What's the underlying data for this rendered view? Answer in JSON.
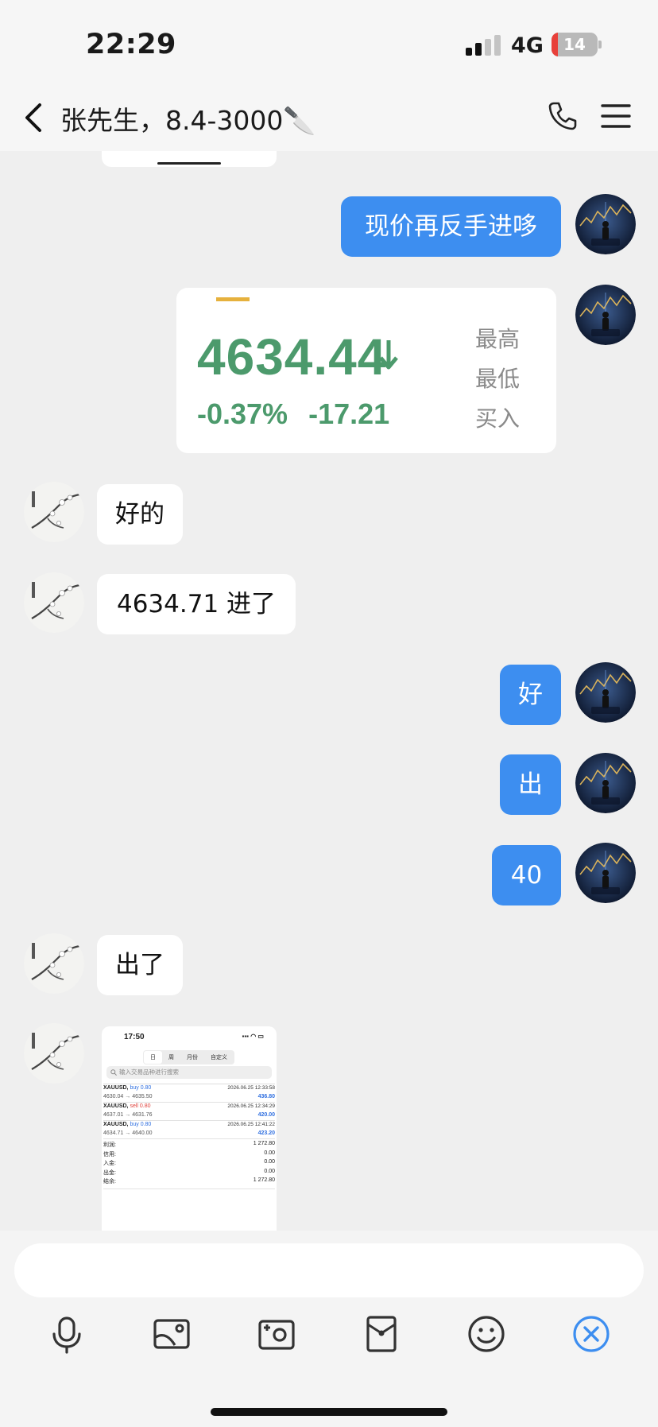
{
  "status_bar": {
    "time": "22:29",
    "network": "4G",
    "battery": "14",
    "battery_level": 0.14
  },
  "header": {
    "title": "张先生，8.4-3000🔪"
  },
  "messages": [
    {
      "from": "me",
      "text": "现价再反手进哆"
    },
    {
      "from": "me",
      "type": "quote_card",
      "price": "4634.44",
      "change_pct": "-0.37%",
      "change_abs": "-17.21",
      "labels": [
        "最高",
        "最低",
        "买入"
      ]
    },
    {
      "from": "other",
      "text": "好的"
    },
    {
      "from": "other",
      "text": "4634.71 进了"
    },
    {
      "from": "me",
      "text": "好"
    },
    {
      "from": "me",
      "text": "出"
    },
    {
      "from": "me",
      "text": "40"
    },
    {
      "from": "other",
      "text": "出了"
    },
    {
      "from": "other",
      "type": "screenshot",
      "time": "17:50",
      "tabs": [
        "日",
        "周",
        "月份",
        "自定义"
      ],
      "search_placeholder": "输入交易品种进行搜索",
      "trades": [
        {
          "symbol": "XAUUSD,",
          "side": "buy 0.80",
          "prices": "4630.04 → 4635.50",
          "date": "2026.06.25 12:33:58",
          "profit": "436.80"
        },
        {
          "symbol": "XAUUSD,",
          "side": "sell 0.80",
          "prices": "4637.01 → 4631.76",
          "date": "2026.06.25 12:34:29",
          "profit": "420.00"
        },
        {
          "symbol": "XAUUSD,",
          "side": "buy 0.80",
          "prices": "4634.71 → 4640.00",
          "date": "2026.06.25 12:41:22",
          "profit": "423.20"
        }
      ],
      "summary": [
        {
          "label": "利润:",
          "value": "1 272.80"
        },
        {
          "label": "信用:",
          "value": "0.00"
        },
        {
          "label": "入金:",
          "value": "0.00"
        },
        {
          "label": "出金:",
          "value": "0.00"
        },
        {
          "label": "结余:",
          "value": "1 272.80"
        }
      ]
    }
  ],
  "toolbar": {
    "icons": [
      "microphone-icon",
      "image-icon",
      "camera-icon",
      "red-packet-icon",
      "emoji-icon",
      "close-circle-icon"
    ]
  },
  "colors": {
    "my_bubble": "#3d8ef0",
    "other_bubble": "#ffffff",
    "quote_green": "#4c9a6c",
    "accent_blue": "#3d8ef0"
  }
}
